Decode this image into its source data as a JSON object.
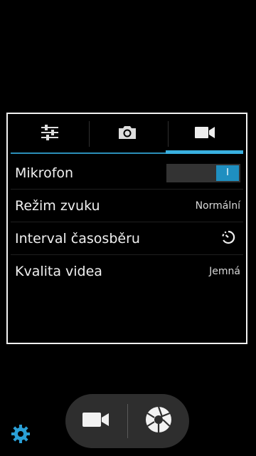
{
  "tabs": [
    {
      "icon": "sliders-icon",
      "active": false
    },
    {
      "icon": "camera-icon",
      "active": false
    },
    {
      "icon": "video-camera-icon",
      "active": true
    }
  ],
  "settings": {
    "microphone": {
      "label": "Mikrofon",
      "toggle_text": "I",
      "on": true
    },
    "sound_mode": {
      "label": "Režim zvuku",
      "value": "Normální"
    },
    "timelapse": {
      "label": "Interval časosběru",
      "icon": "timer-icon"
    },
    "video_quality": {
      "label": "Kvalita videa",
      "value": "Jemná"
    }
  },
  "controls": {
    "mode_icon": "video-camera-icon",
    "shutter_icon": "aperture-icon",
    "settings_icon": "gear-icon"
  },
  "colors": {
    "accent": "#39b0e0",
    "toggle_on": "#1f8fc0",
    "panel_border": "#f2f2f2",
    "background": "#000000"
  }
}
